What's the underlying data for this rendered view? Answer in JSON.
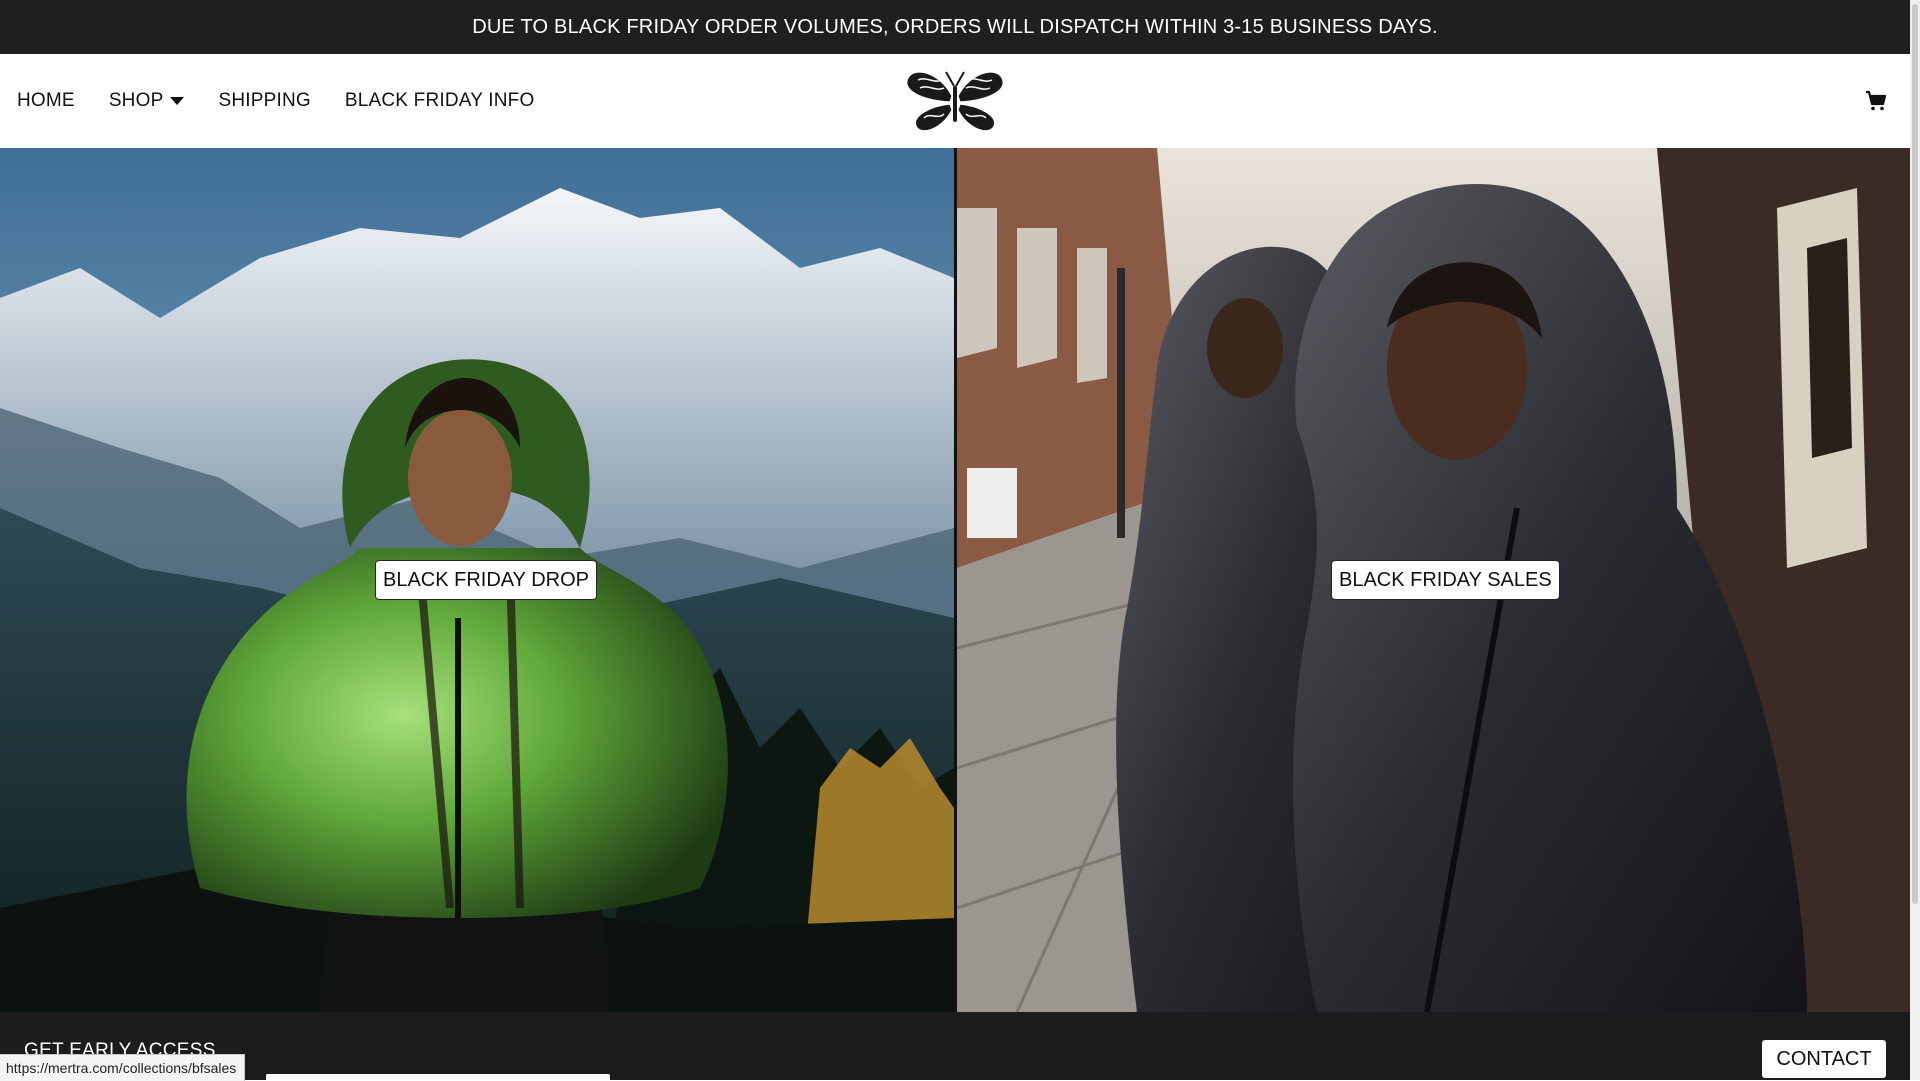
{
  "announcement": "DUE TO BLACK FRIDAY ORDER VOLUMES, ORDERS WILL DISPATCH WITHIN 3-15 BUSINESS DAYS.",
  "nav": {
    "home": "HOME",
    "shop": "SHOP",
    "shipping": "SHIPPING",
    "black_friday_info": "BLACK FRIDAY INFO",
    "logo_icon": "butterfly-logo-icon",
    "cart_icon": "cart-icon"
  },
  "hero": {
    "left": {
      "cta": "BLACK FRIDAY DROP",
      "image": "woman in green puffer jacket in front of mountains"
    },
    "right": {
      "cta": "BLACK FRIDAY SALES",
      "image": "two men in dark hooded jackets on a city street"
    }
  },
  "footer": {
    "early_access": "GET EARLY ACCESS",
    "contact": "CONTACT"
  },
  "status_url": "https://mertra.com/collections/bfsales",
  "colors": {
    "announcement_bg": "#1f1f20",
    "footer_bg": "#1c1c1e",
    "jacket_green": "#5fa83a"
  }
}
